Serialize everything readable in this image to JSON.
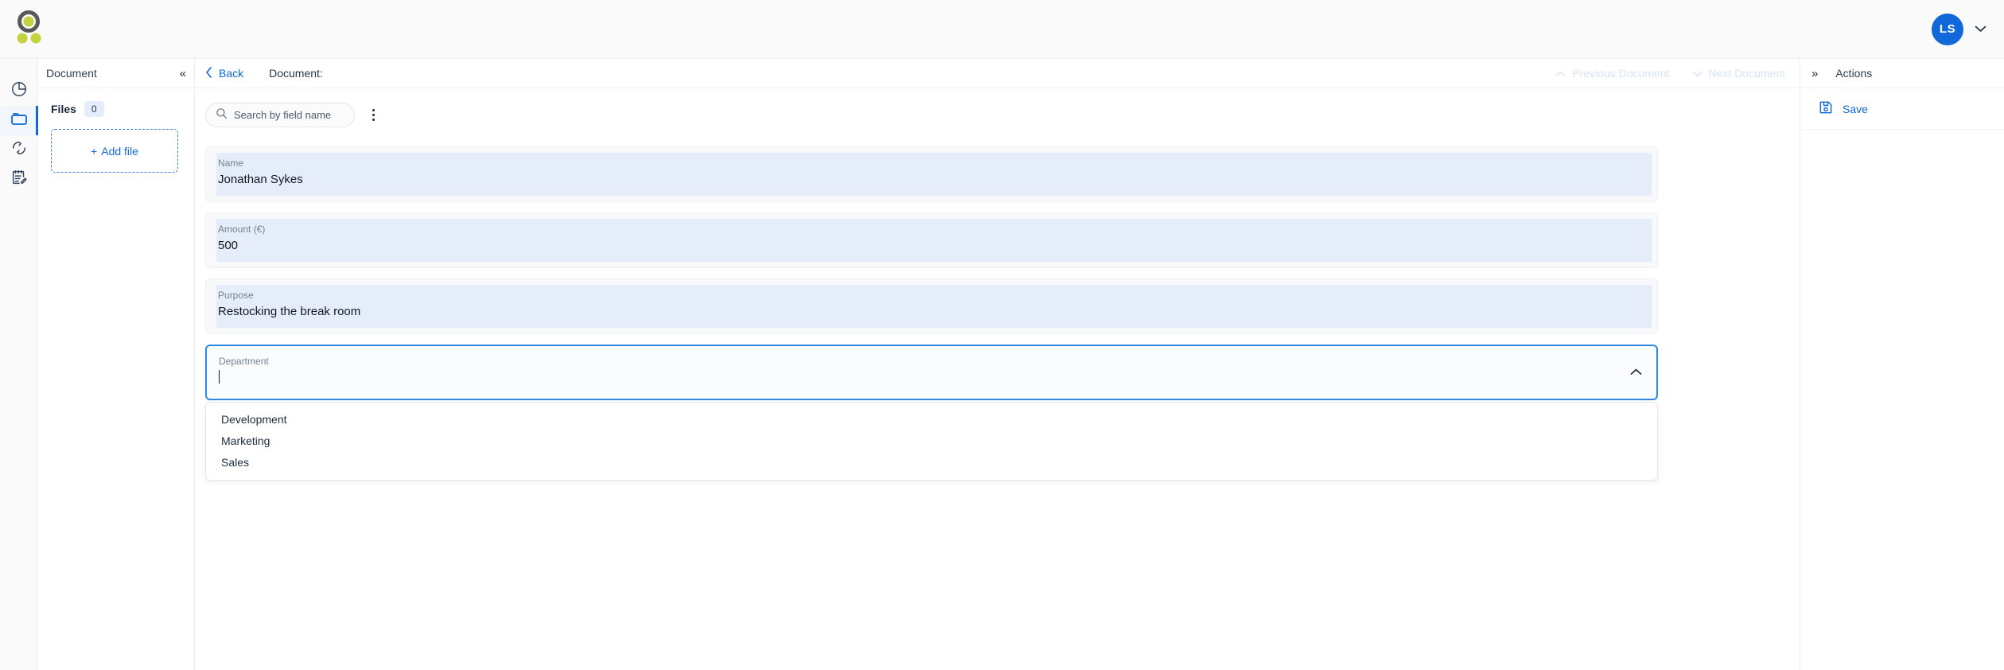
{
  "app": {
    "logo_name": "app-logo",
    "accent_blue": "#1068d9",
    "logo_green": "#c3d23e",
    "logo_gray": "#58595b"
  },
  "topbar": {
    "avatar_initials": "LS",
    "avatar_chevron": "chevron-down-icon"
  },
  "rail": {
    "items": [
      {
        "name": "analytics",
        "icon": "pie-chart-icon",
        "active": false
      },
      {
        "name": "documents",
        "icon": "folder-icon",
        "active": true
      },
      {
        "name": "sync",
        "icon": "refresh-icon",
        "active": false
      },
      {
        "name": "notes",
        "icon": "note-edit-icon",
        "active": false
      }
    ]
  },
  "document_panel": {
    "title": "Document",
    "collapse_icon": "«",
    "files_label": "Files",
    "files_count": "0",
    "add_file_label": "Add file",
    "add_file_plus": "+"
  },
  "main": {
    "back_label": "Back",
    "back_chevron": "‹",
    "doc_title": "Document:",
    "previous_document_label": "Previous Document",
    "next_document_label": "Next Document",
    "previous_chevron": "chevron-up-icon",
    "next_chevron": "chevron-down-icon"
  },
  "toolbar": {
    "search_placeholder": "Search by field name",
    "search_value": "",
    "kebab_name": "more-options-icon"
  },
  "fields": [
    {
      "label": "Name",
      "value": "Jonathan Sykes"
    },
    {
      "label": "Amount (€)",
      "value": "500"
    },
    {
      "label": "Purpose",
      "value": "Restocking the break room"
    }
  ],
  "department_field": {
    "label": "Department",
    "value": "",
    "focused": true,
    "chevron": "chevron-up-icon",
    "options": [
      "Development",
      "Marketing",
      "Sales"
    ]
  },
  "actions_panel": {
    "expand_icon": "»",
    "title": "Actions",
    "save_label": "Save",
    "save_icon": "floppy-disk-icon"
  }
}
